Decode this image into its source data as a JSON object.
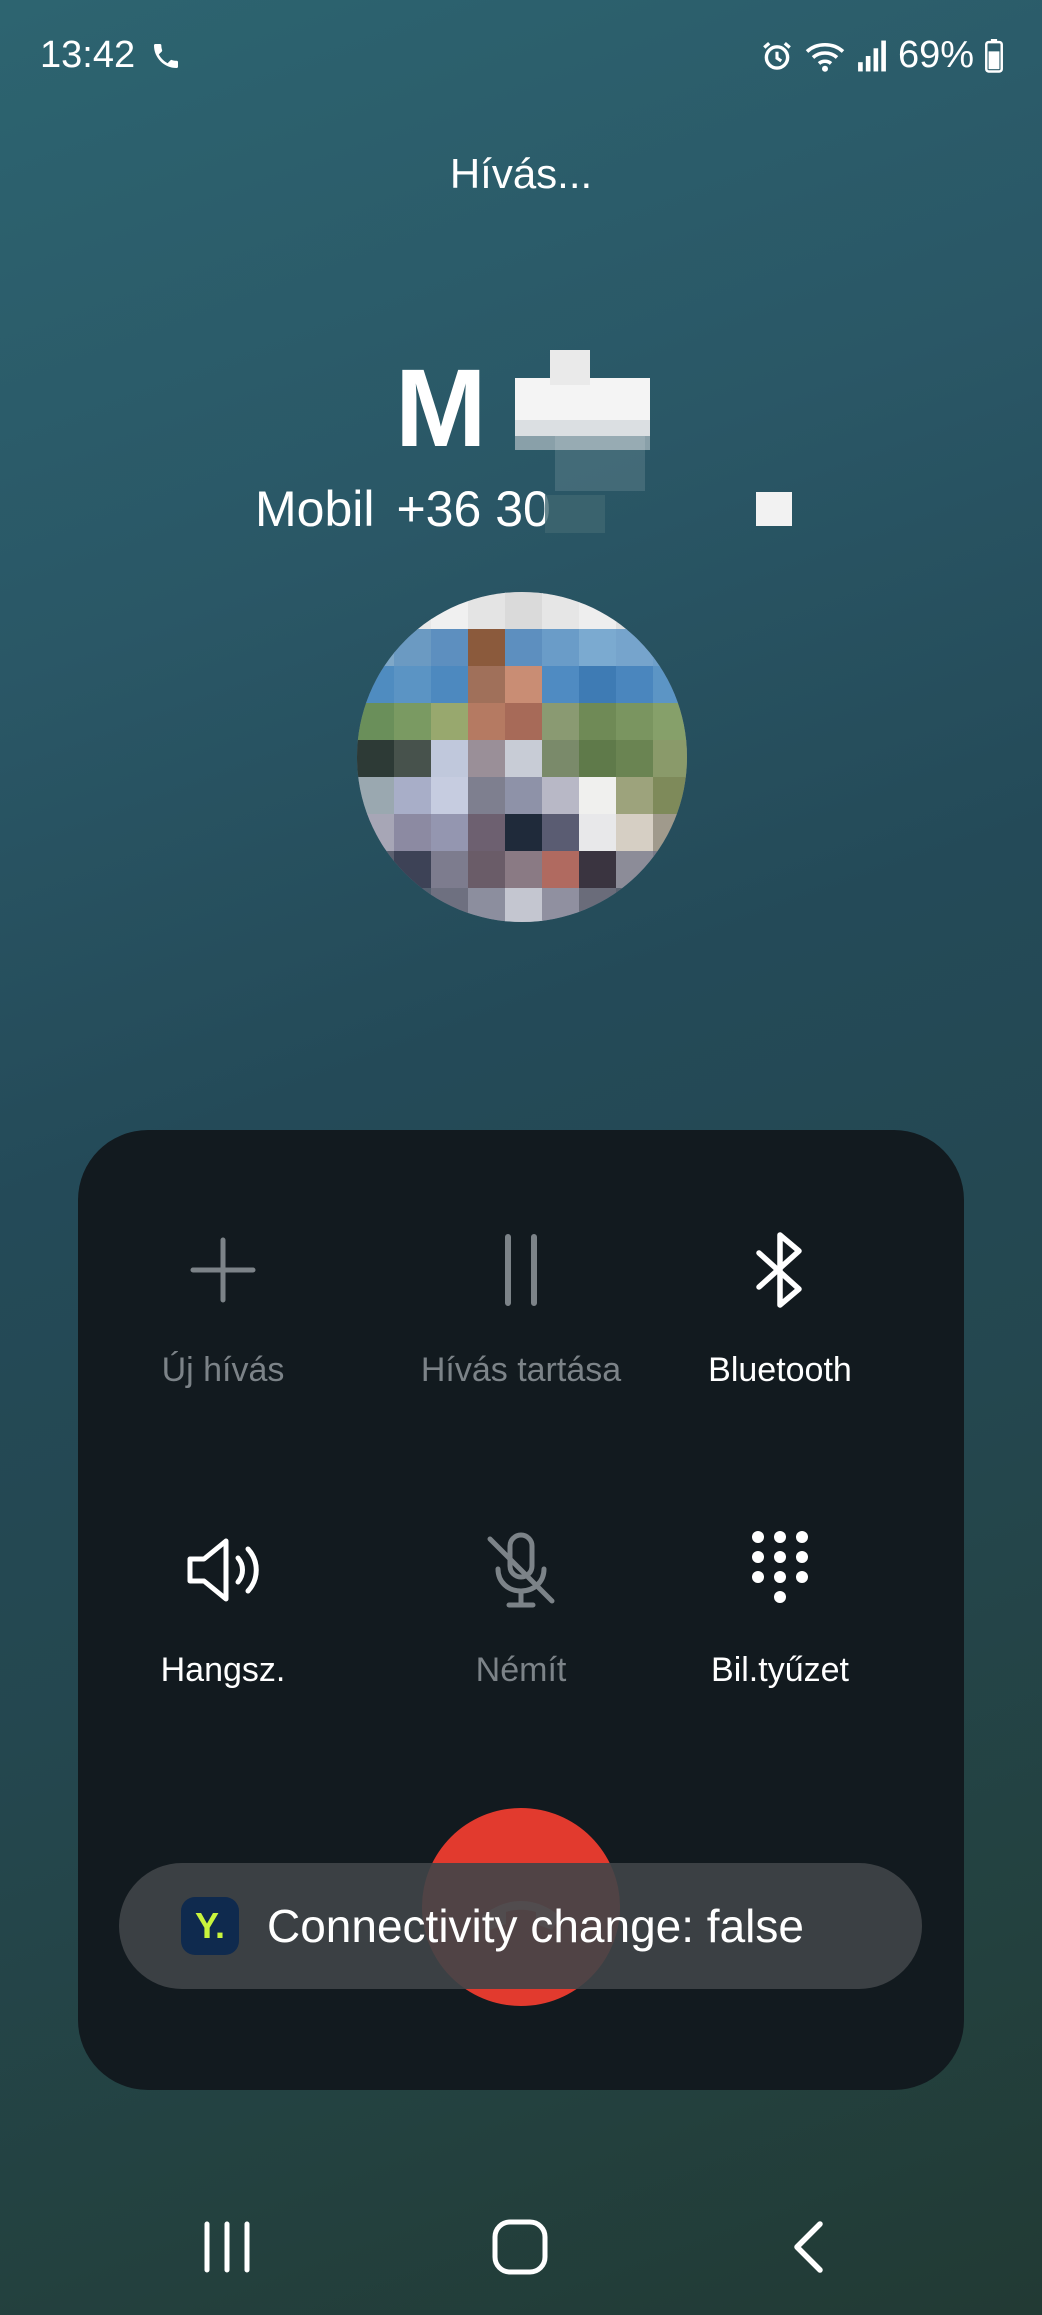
{
  "status_bar": {
    "time": "13:42",
    "battery": "69%",
    "icons": [
      "phone-icon",
      "alarm-icon",
      "wifi-icon",
      "signal-icon",
      "battery-icon"
    ]
  },
  "call": {
    "status": "Hívás...",
    "contact_name_visible": "M",
    "number_type": "Mobil",
    "number_visible": "+36 30"
  },
  "controls": [
    {
      "label": "Új hívás",
      "icon": "plus-icon",
      "enabled": false
    },
    {
      "label": "Hívás tartása",
      "icon": "pause-icon",
      "enabled": false
    },
    {
      "label": "Bluetooth",
      "icon": "bluetooth-icon",
      "enabled": true
    },
    {
      "label": "Hangsz.",
      "icon": "speaker-icon",
      "enabled": true
    },
    {
      "label": "Némít",
      "icon": "mute-icon",
      "enabled": false
    },
    {
      "label": "Bil.tyűzet",
      "icon": "keypad-icon",
      "enabled": true
    }
  ],
  "end_call": {
    "icon": "end-call-icon",
    "color": "#e23a2e"
  },
  "toast": {
    "app_icon_letter": "Y.",
    "text": "Connectivity change: false"
  },
  "navigation": [
    "recents-icon",
    "home-icon",
    "back-icon"
  ],
  "colors": {
    "accent_green": "#c9f43c",
    "end_call_red": "#e23a2e",
    "panel": "#121a1f"
  }
}
